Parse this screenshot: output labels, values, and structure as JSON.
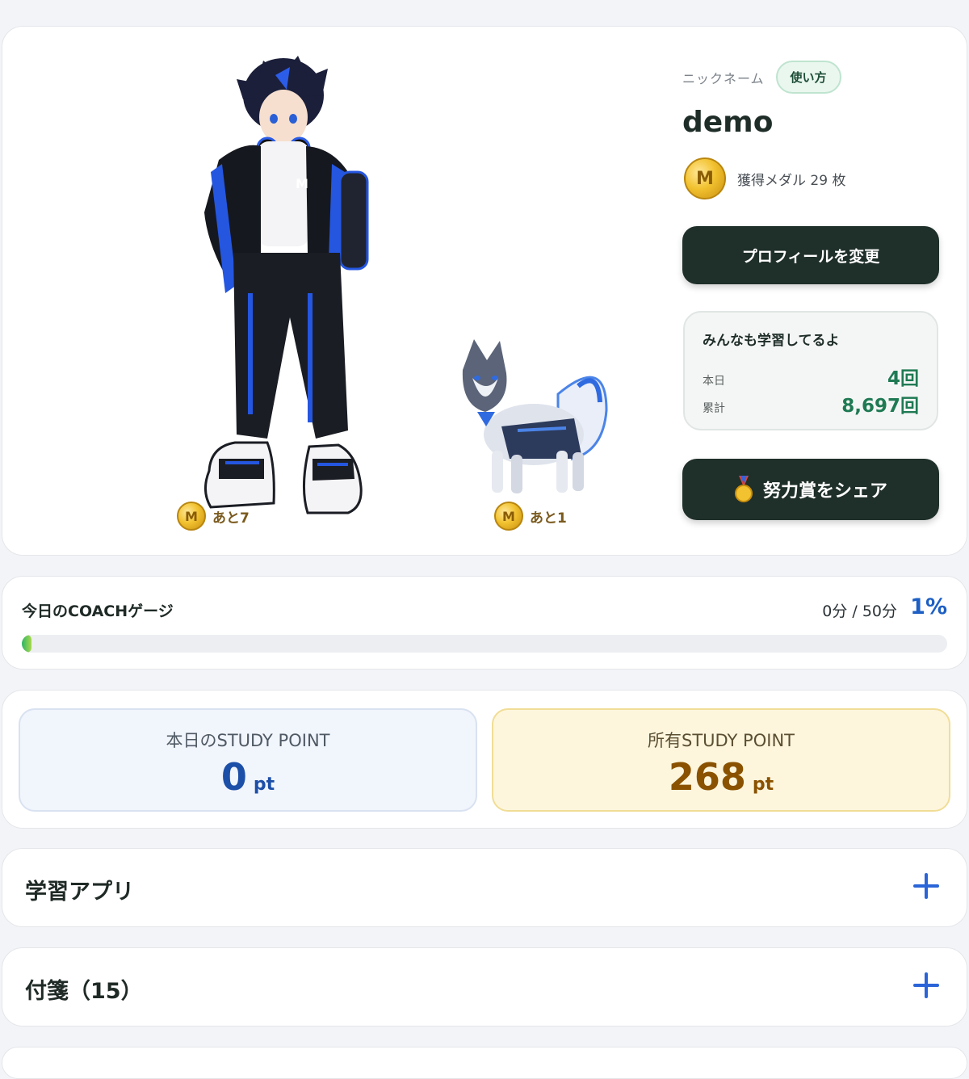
{
  "profile": {
    "nickname_label": "ニックネーム",
    "howto_label": "使い方",
    "nickname": "demo",
    "medal_count_text": "獲得メダル 29 枚",
    "avatar_medal_text": "あと7",
    "pet_medal_text": "あと1",
    "edit_button": "プロフィールを変更",
    "share_button": "努力賞をシェア",
    "stats": {
      "title": "みんなも学習してるよ",
      "today_label": "本日",
      "today_value": "4回",
      "total_label": "累計",
      "total_value": "8,697回"
    }
  },
  "coach": {
    "title": "今日のCOACHゲージ",
    "time_text": "0分 / 50分",
    "percent_text": "1%",
    "progress_fraction": 0.01
  },
  "points": {
    "today_label": "本日のSTUDY POINT",
    "today_value": "0",
    "owned_label": "所有STUDY POINT",
    "owned_value": "268",
    "unit": "pt"
  },
  "sections": {
    "apps_title": "学習アプリ",
    "notes_title": "付箋（15）"
  },
  "icons": {
    "medal": "medal-coin-icon",
    "share": "award-medal-icon",
    "expand": "plus-icon"
  },
  "colors": {
    "dark_button": "#1f2f2a",
    "accent_green": "#1f7a53",
    "accent_blue": "#1d5fc4",
    "owned_gold": "#8a5200"
  }
}
